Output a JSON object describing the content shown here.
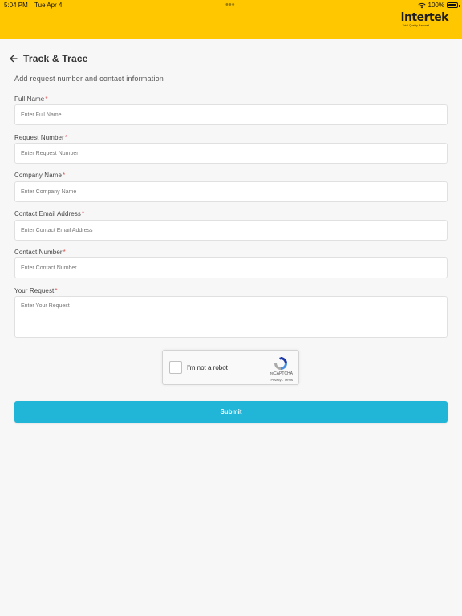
{
  "status_bar": {
    "time": "5:04 PM",
    "date": "Tue Apr 4",
    "dots": "•••",
    "battery": "100%",
    "battery_level": 1.0
  },
  "brand": {
    "name": "intertek",
    "tagline": "Total Quality. Assured.",
    "header_color": "#ffc700"
  },
  "page": {
    "title": "Track & Trace",
    "subtitle": "Add request number and contact information"
  },
  "form": {
    "required_mark": "*",
    "fields": [
      {
        "label": "Full Name",
        "placeholder": "Enter Full Name"
      },
      {
        "label": "Request Number",
        "placeholder": "Enter Request Number"
      },
      {
        "label": "Company Name",
        "placeholder": "Enter Company Name"
      },
      {
        "label": "Contact Email Address",
        "placeholder": "Enter Contact Email Address"
      },
      {
        "label": "Contact Number",
        "placeholder": "Enter Contact Number"
      },
      {
        "label": "Your Request",
        "placeholder": "Enter Your Request"
      }
    ],
    "submit_label": "Submit",
    "submit_color": "#21b5d8"
  },
  "recaptcha": {
    "label": "I'm not a robot",
    "brand": "reCAPTCHA",
    "links": "Privacy - Terms"
  }
}
